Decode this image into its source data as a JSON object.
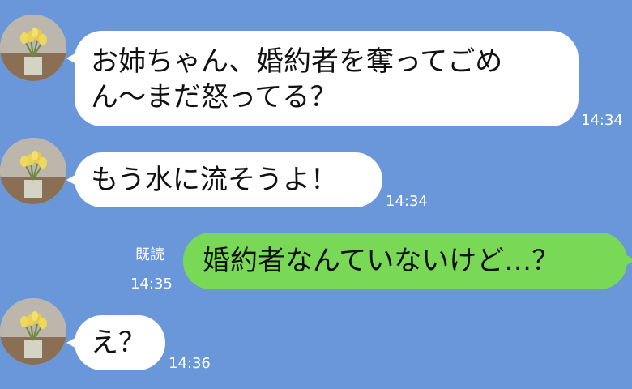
{
  "chat": {
    "colors": {
      "background": "#6a97d9",
      "incoming_bubble": "#ffffff",
      "outgoing_bubble": "#79d957",
      "meta_text": "#ffffff"
    },
    "messages": [
      {
        "sender": "other",
        "avatar_icon": "tulip-vase-icon",
        "lines": [
          "お姉ちゃん、婚約者を奪ってごめ",
          "ん〜まだ怒ってる？"
        ],
        "time": "14:34"
      },
      {
        "sender": "other",
        "avatar_icon": "tulip-vase-icon",
        "text": "もう水に流そうよ！",
        "time": "14:34"
      },
      {
        "sender": "self",
        "read_label": "既読",
        "text": "婚約者なんていないけど…？",
        "time": "14:35"
      },
      {
        "sender": "other",
        "avatar_icon": "tulip-vase-icon",
        "text": "え？",
        "time": "14:36"
      }
    ]
  }
}
